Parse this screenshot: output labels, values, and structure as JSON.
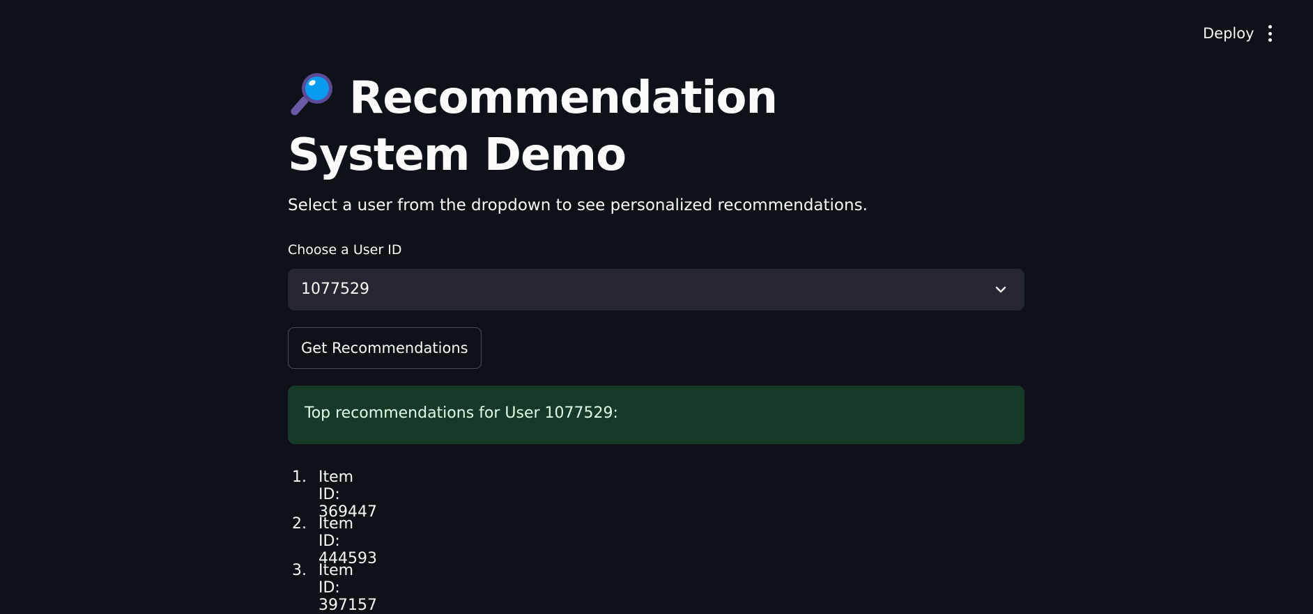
{
  "toolbar": {
    "deploy_label": "Deploy",
    "menu_icon": "more-vertical-icon"
  },
  "header": {
    "icon": "magnifying-glass-icon",
    "title": "Recommendation System Demo"
  },
  "intro": {
    "text": "Select a user from the dropdown to see personalized recommendations."
  },
  "user_select": {
    "label": "Choose a User ID",
    "selected_value": "1077529",
    "icon": "chevron-down-icon"
  },
  "actions": {
    "get_label": "Get Recommendations"
  },
  "result": {
    "message": "Top recommendations for User 1077529:",
    "items": [
      {
        "number": "1.",
        "label": "Item ID: 369447"
      },
      {
        "number": "2.",
        "label": "Item ID: 444593"
      },
      {
        "number": "3.",
        "label": "Item ID: 397157"
      }
    ]
  },
  "colors": {
    "background": "#0e1117",
    "select_background": "#262730",
    "success_background": "#173928",
    "text": "#fafafa"
  }
}
